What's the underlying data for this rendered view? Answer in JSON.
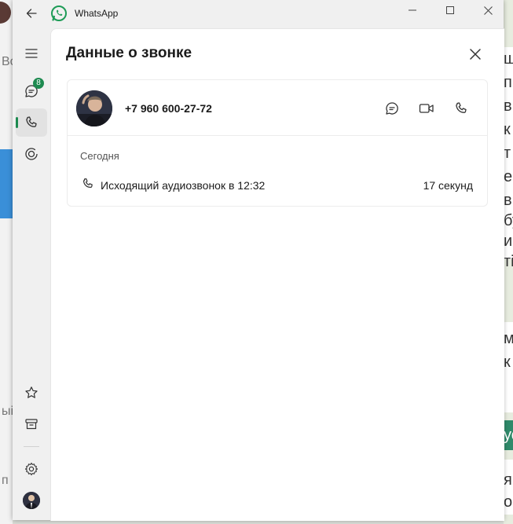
{
  "window": {
    "title": "WhatsApp"
  },
  "rail": {
    "chats_badge": "8"
  },
  "panel": {
    "title": "Данные о звонке",
    "contact": {
      "number": "+7 960 600-27-72"
    },
    "date_section": "Сегодня",
    "call": {
      "description": "Исходящий аудиозвонок в 12:32",
      "duration": "17 секунд"
    }
  },
  "background": {
    "left_fragments": [
      "Во",
      "ыі",
      "п"
    ],
    "right_fragments": [
      "щ",
      "п",
      "в",
      "к",
      "т",
      "ер",
      "в",
      "бу",
      "ир",
      "ті",
      "ми",
      "к",
      "уо",
      "я",
      "ор"
    ]
  },
  "colors": {
    "accent_green": "#1d8a50",
    "panel_bg": "#ffffff",
    "window_bg": "#f0f0f0"
  }
}
